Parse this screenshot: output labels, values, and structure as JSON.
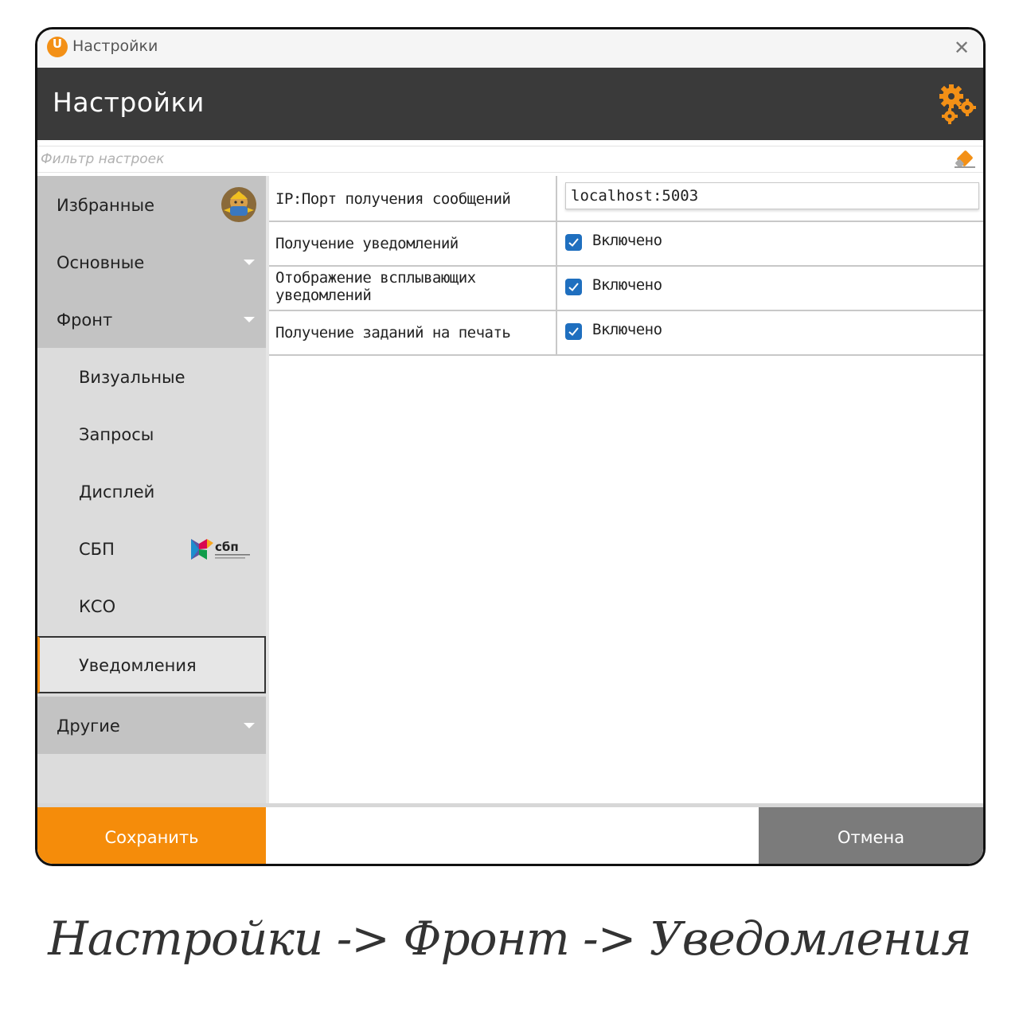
{
  "window": {
    "title": "Настройки",
    "close_glyph": "✕"
  },
  "header": {
    "title": "Настройки",
    "icon": "gears-icon",
    "accent_color": "#f39016"
  },
  "filter": {
    "placeholder": "Фильтр настроек",
    "value": ""
  },
  "sidebar": {
    "favorites": "Избранные",
    "basic": "Основные",
    "front": "Фронт",
    "front_items": [
      "Визуальные",
      "Запросы",
      "Дисплей",
      "СБП",
      "КСО",
      "Уведомления"
    ],
    "selected": "Уведомления",
    "others": "Другие",
    "sbp_logo_text": "сбп"
  },
  "settings": [
    {
      "label": "IP:Порт получения сообщений",
      "type": "text",
      "value": "localhost:5003"
    },
    {
      "label": "Получение уведомлений",
      "type": "checkbox",
      "checked": true,
      "value_label": "Включено"
    },
    {
      "label_line1": "Отображение всплывающих",
      "label_line2": "уведомлений",
      "type": "checkbox",
      "checked": true,
      "value_label": "Включено"
    },
    {
      "label": "Получение заданий на печать",
      "type": "checkbox",
      "checked": true,
      "value_label": "Включено"
    }
  ],
  "footer": {
    "save": "Сохранить",
    "cancel": "Отмена",
    "save_color": "#f58c0a",
    "cancel_color": "#7b7b7b"
  },
  "caption": "Настройки -> Фронт -> Уведомления"
}
